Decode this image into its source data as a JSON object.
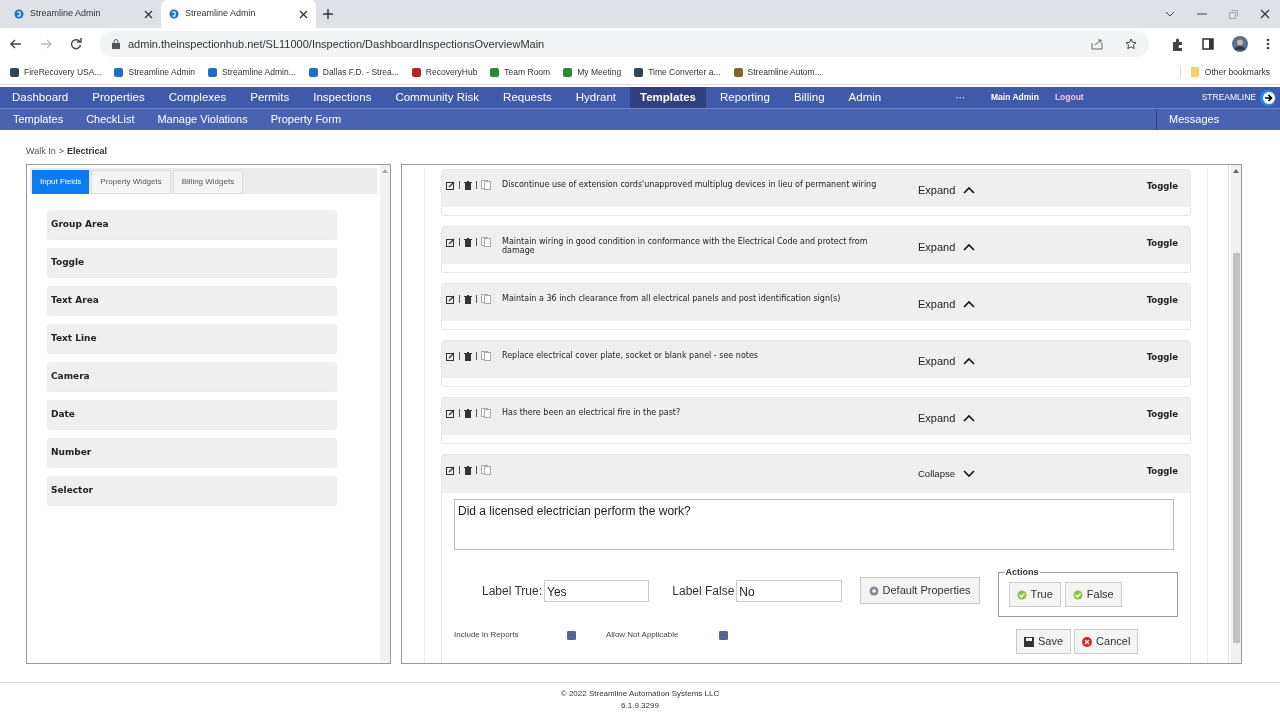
{
  "browser": {
    "tabs": [
      {
        "title": "Streamline Admin",
        "selected": false
      },
      {
        "title": "Streamline Admin",
        "selected": true
      }
    ],
    "url": "admin.theinspectionhub.net/SL11000/Inspection/DashboardInspectionsOverviewMain",
    "bookmarks": [
      "FireRecovery USA...",
      "Streamline Admin",
      "Streamline Admin...",
      "Dallas F.D. - Strea...",
      "RecoveryHub",
      "Team Room",
      "My Meeting",
      "Time Converter a...",
      "Streamline Autom..."
    ],
    "other_bookmarks": "Other bookmarks"
  },
  "nav": {
    "items": [
      {
        "label": "Dashboard",
        "selected": false
      },
      {
        "label": "Properties",
        "selected": false
      },
      {
        "label": "Complexes",
        "selected": false
      },
      {
        "label": "Permits",
        "selected": false
      },
      {
        "label": "Inspections",
        "selected": false
      },
      {
        "label": "Community Risk",
        "selected": false
      },
      {
        "label": "Requests",
        "selected": false
      },
      {
        "label": "Hydrant",
        "selected": false
      },
      {
        "label": "Templates",
        "selected": true
      },
      {
        "label": "Reporting",
        "selected": false
      },
      {
        "label": "Billing",
        "selected": false
      },
      {
        "label": "Admin",
        "selected": false
      }
    ],
    "more": "···",
    "user": "Main Admin",
    "logout": "Logout",
    "brand": "STREAMLINE"
  },
  "subnav": {
    "items": [
      "Templates",
      "CheckList",
      "Manage Violations",
      "Property Form"
    ],
    "messages": "Messages"
  },
  "breadcrumb": {
    "parent": "Walk In",
    "separator": ">",
    "current": "Electrical"
  },
  "widget_panel": {
    "tabs": [
      {
        "label": "Input Fields",
        "selected": true
      },
      {
        "label": "Property Widgets",
        "selected": false
      },
      {
        "label": "Billing Widgets",
        "selected": false
      }
    ],
    "items": [
      "Group Area",
      "Toggle",
      "Text Area",
      "Text Line",
      "Camera",
      "Date",
      "Number",
      "Selector"
    ]
  },
  "questions": [
    {
      "text": "Discontinue use of extension cords'unapproved multiplug devices in lieu of permanent wiring",
      "expand_label": "Expand",
      "expanded": false,
      "type": "Toggle"
    },
    {
      "text": "Maintain wiring in good condition in conformance with the Electrical Code and protect from damage",
      "expand_label": "Expand",
      "expanded": false,
      "type": "Toggle"
    },
    {
      "text": "Maintain a 36 inch clearance from all electrical panels and post identification sign(s)",
      "expand_label": "Expand",
      "expanded": false,
      "type": "Toggle"
    },
    {
      "text": "Replace electrical cover plate, socket or blank panel - see notes",
      "expand_label": "Expand",
      "expanded": false,
      "type": "Toggle"
    },
    {
      "text": "Has there been an electrical fire in the past?",
      "expand_label": "Expand",
      "expanded": false,
      "type": "Toggle"
    },
    {
      "expand_label": "Collapse",
      "expanded": true,
      "type": "Toggle",
      "editor": {
        "question": "Did a licensed electrician perform the work?",
        "label_true": "Label True:",
        "value_true": "Yes",
        "label_false": "Label False",
        "value_false": "No",
        "default_button": "Default Properties",
        "actions_legend": "Actions",
        "actions": [
          "True",
          "False"
        ],
        "include_in_reports": {
          "label": "Include in Reports",
          "checked": true
        },
        "allow_not_applicable": {
          "label": "Allow Not Applicable",
          "checked": true
        },
        "save": "Save",
        "cancel": "Cancel"
      }
    }
  ],
  "footer": {
    "copyright": "© 2022 Streamline Automation Systems LLC",
    "version": "6.1.9.3299"
  }
}
